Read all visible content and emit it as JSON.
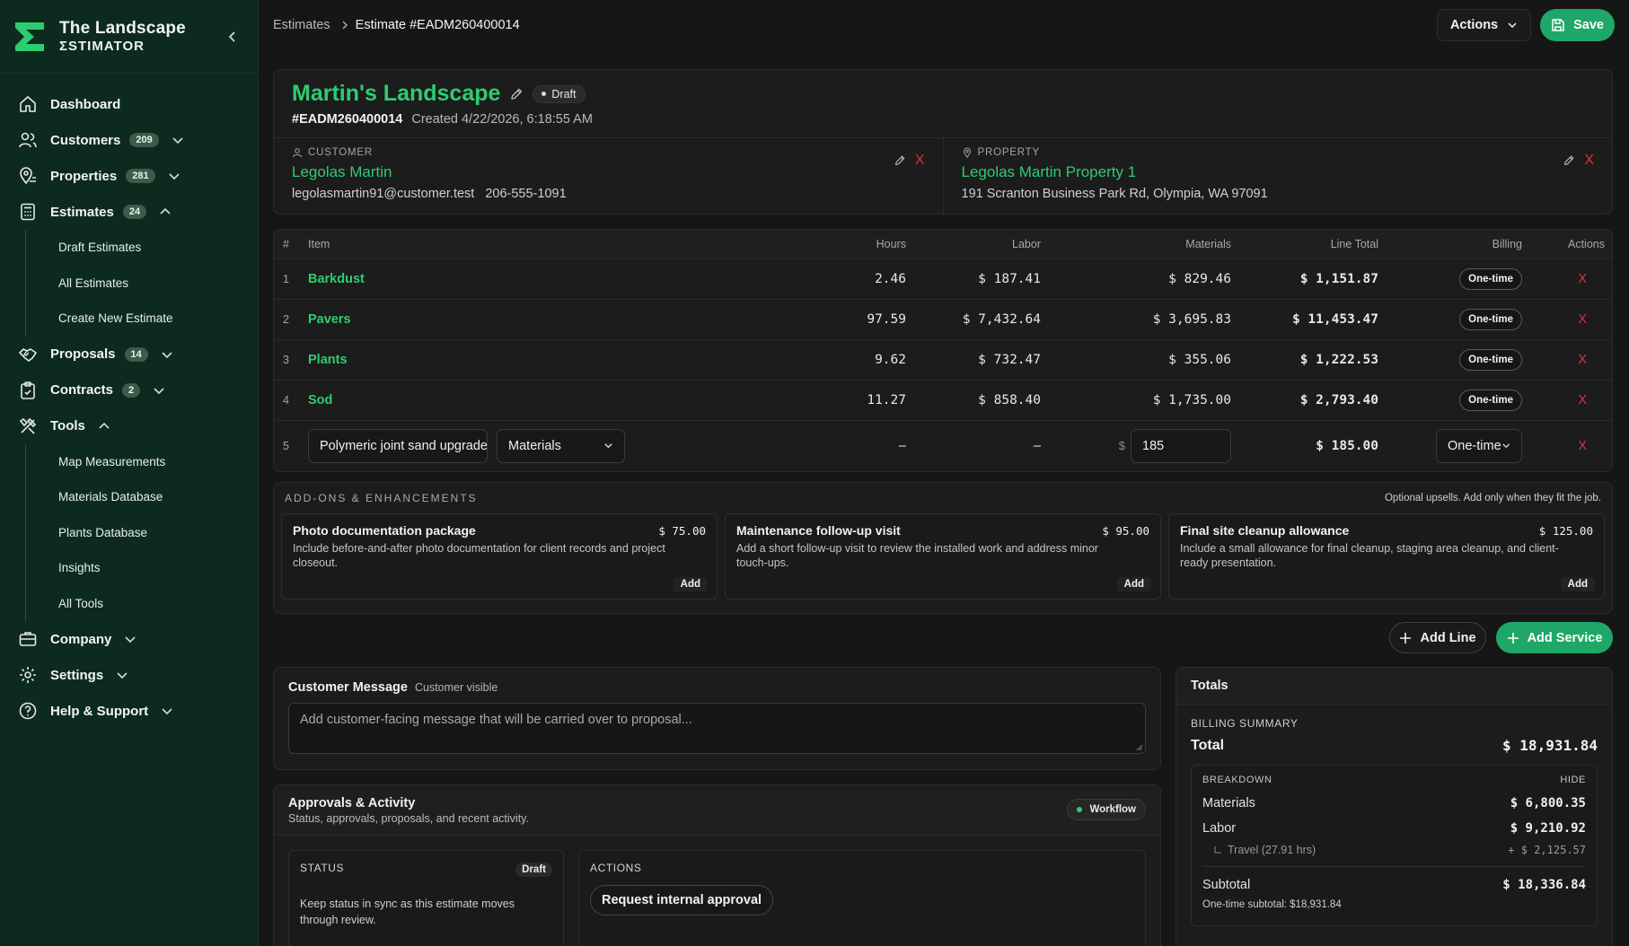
{
  "brand": {
    "line1": "The Landscape",
    "line2": "ƩSTIMATOR"
  },
  "sidebar": {
    "dashboard": "Dashboard",
    "customers": {
      "label": "Customers",
      "count": "209"
    },
    "properties": {
      "label": "Properties",
      "count": "281"
    },
    "estimates": {
      "label": "Estimates",
      "count": "24",
      "children": [
        "Draft Estimates",
        "All Estimates",
        "Create New Estimate"
      ]
    },
    "proposals": {
      "label": "Proposals",
      "count": "14"
    },
    "contracts": {
      "label": "Contracts",
      "count": "2"
    },
    "tools": {
      "label": "Tools",
      "children": [
        "Map Measurements",
        "Materials Database",
        "Plants Database",
        "Insights",
        "All Tools"
      ]
    },
    "company": "Company",
    "settings": "Settings",
    "help": "Help & Support"
  },
  "header": {
    "breadcrumb_root": "Estimates",
    "breadcrumb_current": "Estimate #EADM260400014",
    "actions_label": "Actions",
    "save_label": "Save"
  },
  "estimate": {
    "title": "Martin's Landscape",
    "status": "Draft",
    "number": "#EADM260400014",
    "created": "Created 4/22/2026, 6:18:55 AM",
    "customer_label": "CUSTOMER",
    "customer_name": "Legolas Martin",
    "customer_email": "legolasmartin91@customer.test",
    "customer_phone": "206-555-1091",
    "property_label": "PROPERTY",
    "property_name": "Legolas Martin Property 1",
    "property_address": "191 Scranton Business Park Rd, Olympia, WA 97091",
    "remove_glyph": "X"
  },
  "table": {
    "headers": {
      "num": "#",
      "item": "Item",
      "hours": "Hours",
      "labor": "Labor",
      "materials": "Materials",
      "line_total": "Line Total",
      "billing": "Billing",
      "actions": "Actions"
    },
    "rows": [
      {
        "num": "1",
        "item": "Barkdust",
        "hours": "2.46",
        "labor": "$ 187.41",
        "materials": "$ 829.46",
        "total": "$ 1,151.87",
        "billing": "One-time"
      },
      {
        "num": "2",
        "item": "Pavers",
        "hours": "97.59",
        "labor": "$ 7,432.64",
        "materials": "$ 3,695.83",
        "total": "$ 11,453.47",
        "billing": "One-time"
      },
      {
        "num": "3",
        "item": "Plants",
        "hours": "9.62",
        "labor": "$ 732.47",
        "materials": "$ 355.06",
        "total": "$ 1,222.53",
        "billing": "One-time"
      },
      {
        "num": "4",
        "item": "Sod",
        "hours": "11.27",
        "labor": "$ 858.40",
        "materials": "$ 1,735.00",
        "total": "$ 2,793.40",
        "billing": "One-time"
      }
    ],
    "custom_row": {
      "num": "5",
      "item_value": "Polymeric joint sand upgrade",
      "type_value": "Materials",
      "hours": "–",
      "labor": "–",
      "dollar": "$",
      "materials_value": "185",
      "total": "$ 185.00",
      "billing": "One-time"
    },
    "remove_glyph": "X"
  },
  "addons": {
    "title": "ADD-ONS & ENHANCEMENTS",
    "note": "Optional upsells. Add only when they fit the job.",
    "items": [
      {
        "title": "Photo documentation package",
        "price": "$ 75.00",
        "desc": "Include before-and-after photo documentation for client records and project closeout.",
        "btn": "Add"
      },
      {
        "title": "Maintenance follow-up visit",
        "price": "$ 95.00",
        "desc": "Add a short follow-up visit to review the installed work and address minor touch-ups.",
        "btn": "Add"
      },
      {
        "title": "Final site cleanup allowance",
        "price": "$ 125.00",
        "desc": "Include a small allowance for final cleanup, staging area cleanup, and client-ready presentation.",
        "btn": "Add"
      }
    ]
  },
  "buttons": {
    "add_line": "Add Line",
    "add_service": "Add Service"
  },
  "message": {
    "title": "Customer Message",
    "visibility": "Customer visible",
    "placeholder": "Add customer-facing message that will be carried over to proposal..."
  },
  "approvals": {
    "title": "Approvals & Activity",
    "subtitle": "Status, approvals, proposals, and recent activity.",
    "chip": "Workflow",
    "status_label": "STATUS",
    "status_value": "Draft",
    "status_text": "Keep status in sync as this estimate moves through review.",
    "actions_label": "ACTIONS",
    "request_btn": "Request internal approval"
  },
  "totals": {
    "title": "Totals",
    "summary_label": "BILLING SUMMARY",
    "total_label": "Total",
    "total_value": "$ 18,931.84",
    "breakdown_label": "BREAKDOWN",
    "hide_label": "HIDE",
    "materials_label": "Materials",
    "materials_value": "$ 6,800.35",
    "labor_label": "Labor",
    "labor_value": "$ 9,210.92",
    "travel_label": "Travel (27.91 hrs)",
    "travel_value": "+ $ 2,125.57",
    "subtotal_label": "Subtotal",
    "subtotal_value": "$ 18,336.84",
    "onetime_note": "One-time subtotal: $18,931.84"
  },
  "colors": {
    "accent": "#2ecc71",
    "button_green": "#1ea768",
    "sidebar_bg": "#0c2b1e",
    "danger": "#e0313a"
  }
}
